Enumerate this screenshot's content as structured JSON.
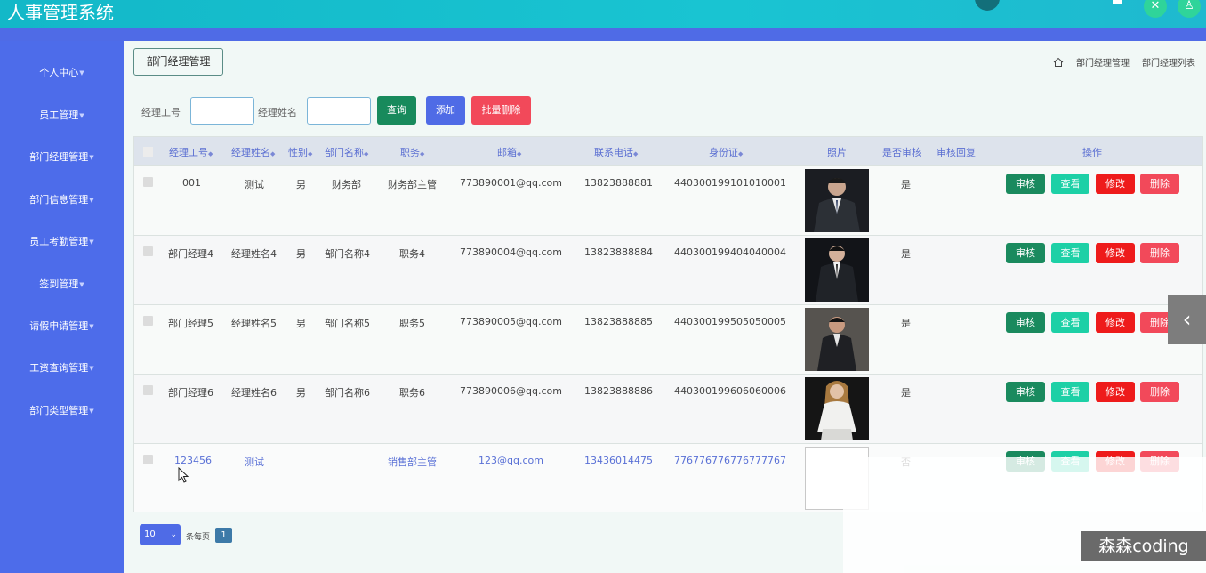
{
  "app": {
    "title": "人事管理系统",
    "top_center_text": "“ “         “"
  },
  "sidebar": {
    "items": [
      {
        "label": "个人中心"
      },
      {
        "label": "员工管理"
      },
      {
        "label": "部门经理管理"
      },
      {
        "label": "部门信息管理"
      },
      {
        "label": "员工考勤管理"
      },
      {
        "label": "签到管理"
      },
      {
        "label": "请假申请管理"
      },
      {
        "label": "工资查询管理"
      },
      {
        "label": "部门类型管理"
      }
    ]
  },
  "page_tag": "部门经理管理",
  "breadcrumb": {
    "items": [
      "部门经理管理",
      "部门经理列表"
    ]
  },
  "search": {
    "manager_id_label": "经理工号",
    "manager_name_label": "经理姓名",
    "manager_id_value": "",
    "manager_name_value": "",
    "query_label": "查询",
    "add_label": "添加",
    "batch_delete_label": "批量删除"
  },
  "table": {
    "headers": {
      "manager_id": "经理工号",
      "manager_name": "经理姓名",
      "gender": "性别",
      "dept_name": "部门名称",
      "position": "职务",
      "email": "邮箱",
      "phone": "联系电话",
      "id_card": "身份证",
      "photo": "照片",
      "audit_status": "是否审核",
      "audit_reply": "审核回复",
      "actions": "操作"
    },
    "rows": [
      {
        "manager_id": "001",
        "manager_name": "测试",
        "gender": "男",
        "dept_name": "财务部",
        "position": "财务部主管",
        "email": "773890001@qq.com",
        "phone": "13823888881",
        "id_card": "440300199101010001",
        "audit_status": "是"
      },
      {
        "manager_id": "部门经理4",
        "manager_name": "经理姓名4",
        "gender": "男",
        "dept_name": "部门名称4",
        "position": "职务4",
        "email": "773890004@qq.com",
        "phone": "13823888884",
        "id_card": "440300199404040004",
        "audit_status": "是"
      },
      {
        "manager_id": "部门经理5",
        "manager_name": "经理姓名5",
        "gender": "男",
        "dept_name": "部门名称5",
        "position": "职务5",
        "email": "773890005@qq.com",
        "phone": "13823888885",
        "id_card": "440300199505050005",
        "audit_status": "是"
      },
      {
        "manager_id": "部门经理6",
        "manager_name": "经理姓名6",
        "gender": "男",
        "dept_name": "部门名称6",
        "position": "职务6",
        "email": "773890006@qq.com",
        "phone": "13823888886",
        "id_card": "440300199606060006",
        "audit_status": "是"
      },
      {
        "manager_id": "123456",
        "manager_name": "测试",
        "gender": "",
        "dept_name": "",
        "position": "销售部主管",
        "email": "123@qq.com",
        "phone": "13436014475",
        "id_card": "776776776776777767",
        "audit_status": "否"
      }
    ],
    "actions": {
      "audit": "审核",
      "view": "查看",
      "edit": "修改",
      "delete": "删除"
    }
  },
  "pager": {
    "page_size": "10",
    "per_page_label": "条每页",
    "current_page": "1"
  },
  "watermark": "森森coding",
  "colors": {
    "topbar": "#19c4d2",
    "sidebar": "#4d6cea",
    "content_bg": "#f1f8f6",
    "accent_blue": "#4f6be6",
    "query_green": "#188a5c",
    "danger": "#f2495a",
    "edit_red": "#ee1b1b",
    "view_teal": "#1dd0a6"
  },
  "icons": [
    "home-icon",
    "chevron-down-icon",
    "chevron-left-icon",
    "minimize-icon",
    "close-icon",
    "user-icon",
    "sort-icon",
    "mouse-cursor-icon"
  ]
}
